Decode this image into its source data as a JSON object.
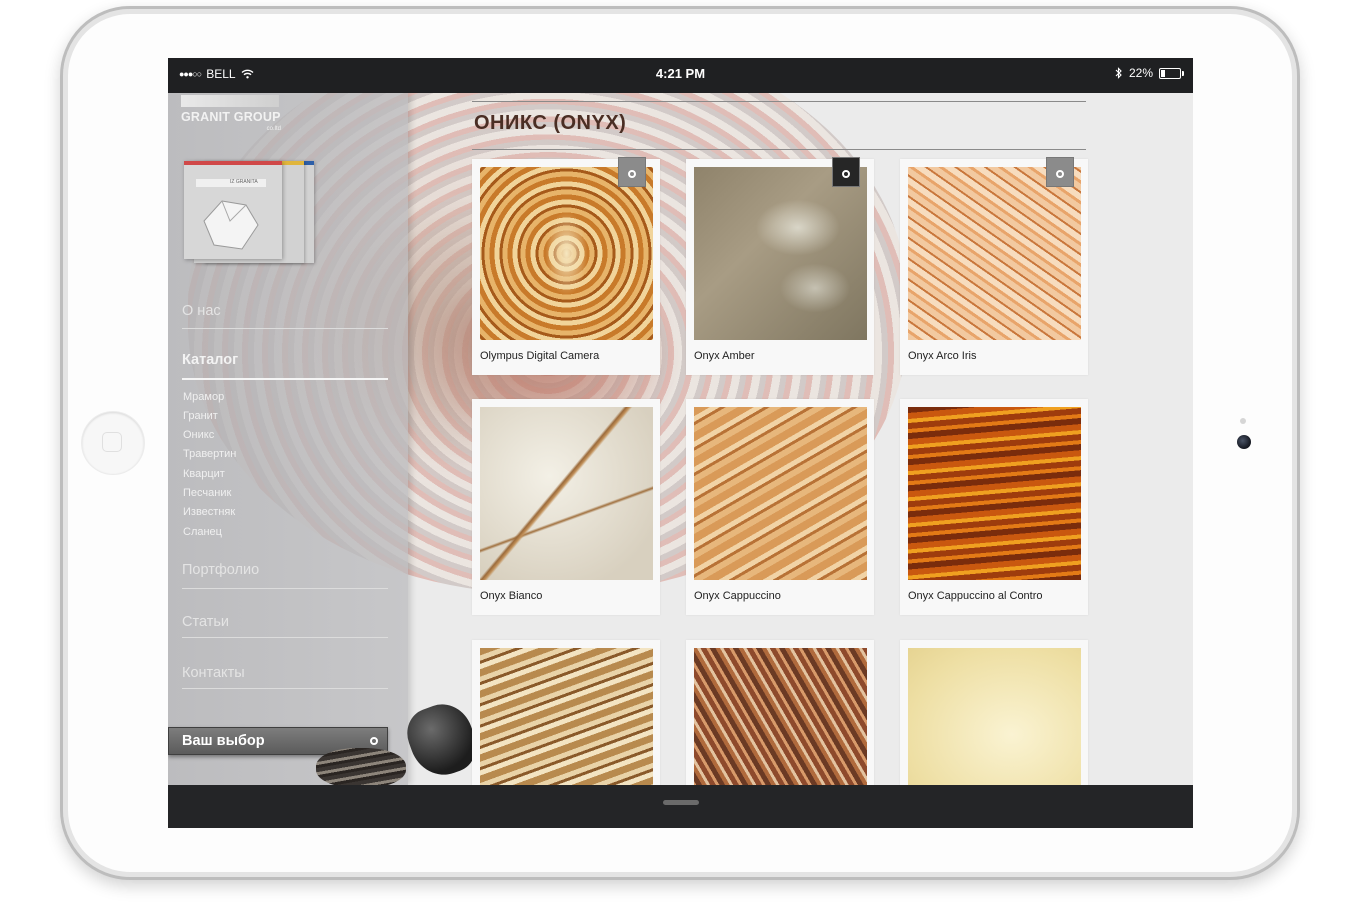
{
  "status_bar": {
    "carrier": "BELL",
    "time": "4:21 PM",
    "battery": "22%",
    "battery_level": 0.22
  },
  "brand": {
    "name": "GRANIT GROUP",
    "suffix": "co.ltd",
    "card_text": "IZ GRANITA"
  },
  "nav": {
    "about": "О нас",
    "catalog": "Каталог",
    "catalog_sub": [
      "Мрамор",
      "Гранит",
      "Оникс",
      "Травертин",
      "Кварцит",
      "Песчаник",
      "Известняк",
      "Сланец"
    ],
    "portfolio": "Портфолио",
    "articles": "Статьи",
    "contacts": "Контакты",
    "choice": "Ваш выбор"
  },
  "page": {
    "title": "ОНИКС (ONYX)"
  },
  "products": [
    {
      "name": "Olympus Digital Camera",
      "selected": true
    },
    {
      "name": "Onyx Amber",
      "selected": true
    },
    {
      "name": "Onyx Arco Iris",
      "selected": true
    },
    {
      "name": "Onyx Bianco",
      "selected": false
    },
    {
      "name": "Onyx Cappuccino",
      "selected": false
    },
    {
      "name": "Onyx Cappuccino al Contro",
      "selected": false
    },
    {
      "name": "",
      "selected": false
    },
    {
      "name": "",
      "selected": false
    },
    {
      "name": "",
      "selected": false
    }
  ],
  "icons": {
    "signal": "signal-dots-icon",
    "wifi": "wifi-icon",
    "bluetooth": "bluetooth-icon",
    "battery": "battery-icon",
    "select": "select-ring-icon"
  }
}
